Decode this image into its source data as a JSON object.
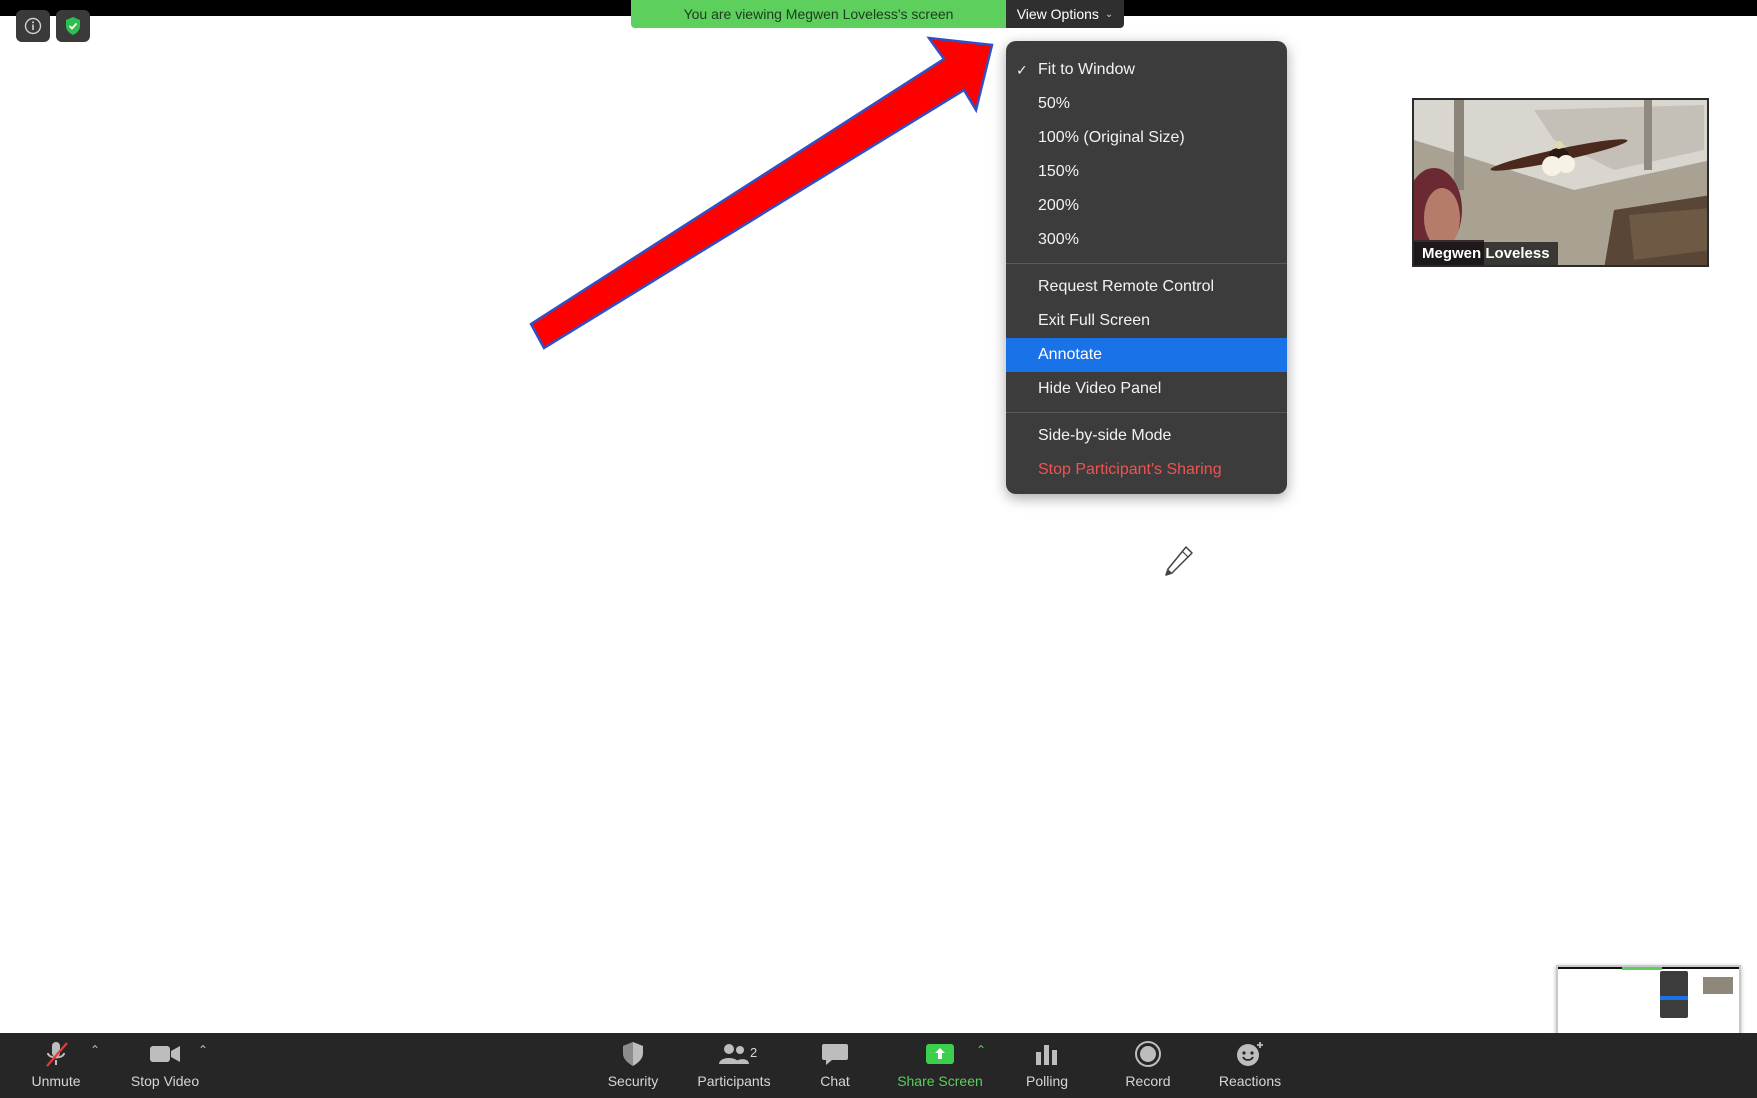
{
  "banner": {
    "viewing_text": "You are viewing Megwen Loveless's screen",
    "view_options_label": "View Options"
  },
  "top_icons": [
    "info-icon",
    "shield-check-icon"
  ],
  "menu": {
    "items": [
      {
        "label": "Fit to Window",
        "checked": true
      },
      {
        "label": "50%"
      },
      {
        "label": "100% (Original Size)"
      },
      {
        "label": "150%"
      },
      {
        "label": "200%"
      },
      {
        "label": "300%"
      },
      {
        "label": "Request Remote Control"
      },
      {
        "label": "Exit Full Screen"
      },
      {
        "label": "Annotate",
        "highlighted": true
      },
      {
        "label": "Hide Video Panel"
      },
      {
        "label": "Side-by-side Mode"
      },
      {
        "label": "Stop Participant's Sharing",
        "danger": true
      }
    ]
  },
  "video": {
    "participant_name": "Megwen Loveless"
  },
  "toolbar": {
    "unmute": "Unmute",
    "stop_video": "Stop Video",
    "security": "Security",
    "participants": "Participants",
    "participants_count": "2",
    "chat": "Chat",
    "share_screen": "Share Screen",
    "polling": "Polling",
    "record": "Record",
    "reactions": "Reactions"
  },
  "colors": {
    "banner_green": "#5ccf5c",
    "highlight_blue": "#1a72e8",
    "danger_red": "#ef5350",
    "toolbar_bg": "#262626",
    "menu_bg": "#3c3c3c"
  }
}
